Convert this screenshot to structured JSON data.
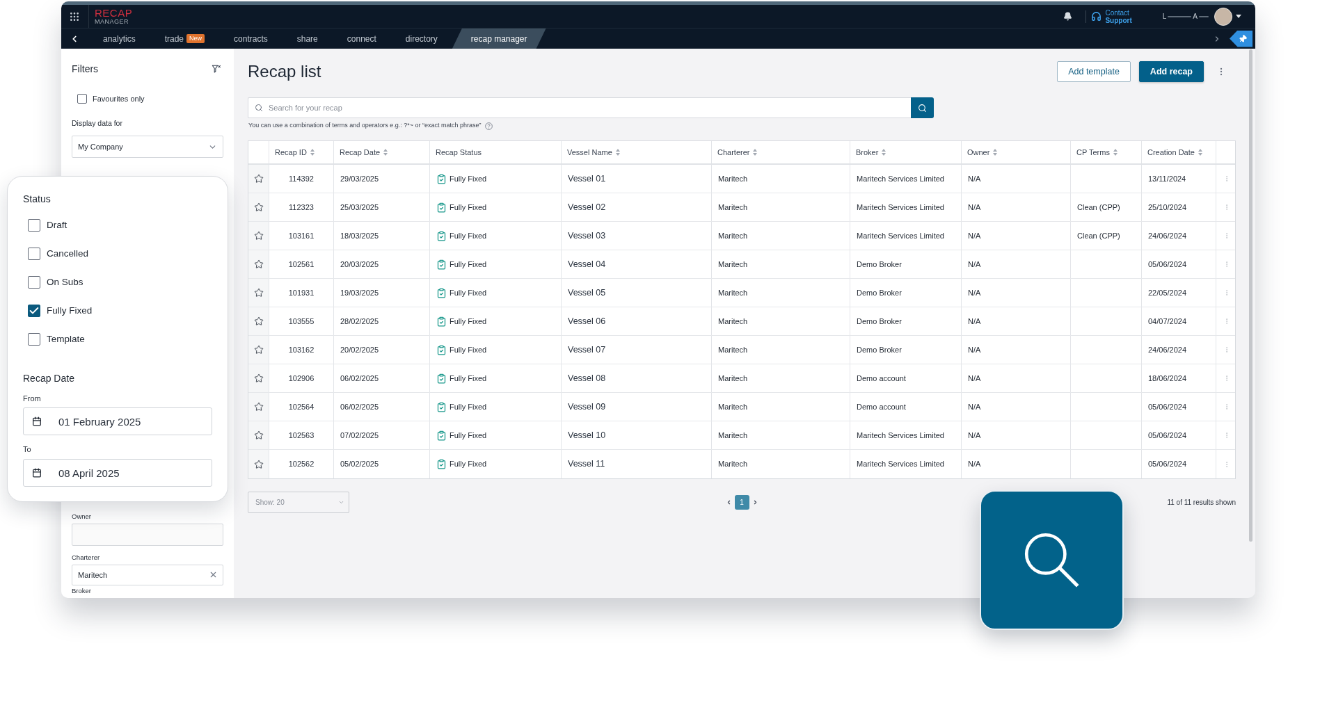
{
  "app_bar": {
    "logo": {
      "line_1": "RECAP",
      "line_2": "MANAGER"
    },
    "support": {
      "line_1": "Contact",
      "line_2": "Support"
    },
    "user": {
      "name_parts": [
        "L",
        "A"
      ]
    }
  },
  "nav": {
    "tabs": [
      {
        "label": "analytics",
        "selected": false
      },
      {
        "label": "trade",
        "badge": "New",
        "selected": false
      },
      {
        "label": "contracts",
        "selected": false
      },
      {
        "label": "share",
        "selected": false
      },
      {
        "label": "connect",
        "selected": false
      },
      {
        "label": "directory",
        "selected": false
      },
      {
        "label": "recap manager",
        "selected": true
      }
    ]
  },
  "filters": {
    "title": "Filters",
    "favourites": {
      "label": "Favourites only",
      "checked": false
    },
    "display_data": {
      "label": "Display data for",
      "value": "My Company"
    },
    "owner": {
      "label": "Owner"
    },
    "charterer": {
      "label": "Charterer",
      "value": "Maritech"
    },
    "broker": {
      "label": "Broker"
    }
  },
  "status_card": {
    "title": "Status",
    "options": [
      {
        "label": "Draft",
        "checked": false
      },
      {
        "label": "Cancelled",
        "checked": false
      },
      {
        "label": "On Subs",
        "checked": false
      },
      {
        "label": "Fully Fixed",
        "checked": true
      },
      {
        "label": "Template",
        "checked": false
      }
    ],
    "recap_date": {
      "title": "Recap Date",
      "from": {
        "label": "From",
        "value": "01 February 2025"
      },
      "to": {
        "label": "To",
        "value": "08 April 2025"
      }
    }
  },
  "page": {
    "title": "Recap list",
    "buttons": [
      {
        "label": "Add template",
        "kind": "outline"
      },
      {
        "label": "Add recap",
        "kind": "primary"
      }
    ],
    "search": {
      "placeholder": "Search for your recap",
      "hint": "You can use a combination of terms and operators e.g.: ?*~ or “exact match phrase”"
    }
  },
  "table": {
    "columns": [
      {
        "label": "Recap ID",
        "sortable": true
      },
      {
        "label": "Recap Date",
        "sortable": true
      },
      {
        "label": "Recap Status",
        "sortable": false
      },
      {
        "label": "Vessel Name",
        "sortable": true
      },
      {
        "label": "Charterer",
        "sortable": true
      },
      {
        "label": "Broker",
        "sortable": true
      },
      {
        "label": "Owner",
        "sortable": true
      },
      {
        "label": "CP Terms",
        "sortable": true
      },
      {
        "label": "Creation Date",
        "sortable": true
      }
    ],
    "rows": [
      {
        "favourite": false,
        "recap_id": "114392",
        "recap_date": "29/03/2025",
        "status": "Fully Fixed",
        "vessel_name": "Vessel 01",
        "charterer": "Maritech",
        "broker": "Maritech Services Limited",
        "owner": "N/A",
        "creation_date": "13/11/2024"
      },
      {
        "favourite": false,
        "recap_id": "112323",
        "recap_date": "25/03/2025",
        "status": "Fully Fixed",
        "vessel_name": "Vessel 02",
        "charterer": "Maritech",
        "broker": "Maritech Services Limited",
        "owner": "N/A",
        "cp_terms": "Clean (CPP)",
        "creation_date": "25/10/2024"
      },
      {
        "favourite": false,
        "recap_id": "103161",
        "recap_date": "18/03/2025",
        "status": "Fully Fixed",
        "vessel_name": "Vessel 03",
        "charterer": "Maritech",
        "broker": "Maritech Services Limited",
        "owner": "N/A",
        "cp_terms": "Clean (CPP)",
        "creation_date": "24/06/2024"
      },
      {
        "favourite": false,
        "recap_id": "102561",
        "recap_date": "20/03/2025",
        "status": "Fully Fixed",
        "vessel_name": "Vessel 04",
        "charterer": "Maritech",
        "broker": "Demo Broker",
        "owner": "N/A",
        "creation_date": "05/06/2024"
      },
      {
        "favourite": false,
        "recap_id": "101931",
        "recap_date": "19/03/2025",
        "status": "Fully Fixed",
        "vessel_name": "Vessel 05",
        "charterer": "Maritech",
        "broker": "Demo Broker",
        "owner": "N/A",
        "creation_date": "22/05/2024"
      },
      {
        "favourite": false,
        "recap_id": "103555",
        "recap_date": "28/02/2025",
        "status": "Fully Fixed",
        "vessel_name": "Vessel 06",
        "charterer": "Maritech",
        "broker": "Demo Broker",
        "owner": "N/A",
        "creation_date": "04/07/2024"
      },
      {
        "favourite": false,
        "recap_id": "103162",
        "recap_date": "20/02/2025",
        "status": "Fully Fixed",
        "vessel_name": "Vessel 07",
        "charterer": "Maritech",
        "broker": "Demo Broker",
        "owner": "N/A",
        "creation_date": "24/06/2024"
      },
      {
        "favourite": false,
        "recap_id": "102906",
        "recap_date": "06/02/2025",
        "status": "Fully Fixed",
        "vessel_name": "Vessel 08",
        "charterer": "Maritech",
        "broker": "Demo account",
        "owner": "N/A",
        "creation_date": "18/06/2024"
      },
      {
        "favourite": false,
        "recap_id": "102564",
        "recap_date": "06/02/2025",
        "status": "Fully Fixed",
        "vessel_name": "Vessel 09",
        "charterer": "Maritech",
        "broker": "Demo account",
        "owner": "N/A",
        "creation_date": "05/06/2024"
      },
      {
        "favourite": false,
        "recap_id": "102563",
        "recap_date": "07/02/2025",
        "status": "Fully Fixed",
        "vessel_name": "Vessel 10",
        "charterer": "Maritech",
        "broker": "Maritech Services Limited",
        "owner": "N/A",
        "creation_date": "05/06/2024"
      },
      {
        "favourite": false,
        "recap_id": "102562",
        "recap_date": "05/02/2025",
        "status": "Fully Fixed",
        "vessel_name": "Vessel 11",
        "charterer": "Maritech",
        "broker": "Maritech Services Limited",
        "owner": "N/A",
        "creation_date": "05/06/2024"
      }
    ]
  },
  "footer": {
    "page_size": "Show: 20",
    "pages": [
      {
        "label": "1",
        "selected": true
      }
    ],
    "results": "11 of 11 results shown"
  }
}
